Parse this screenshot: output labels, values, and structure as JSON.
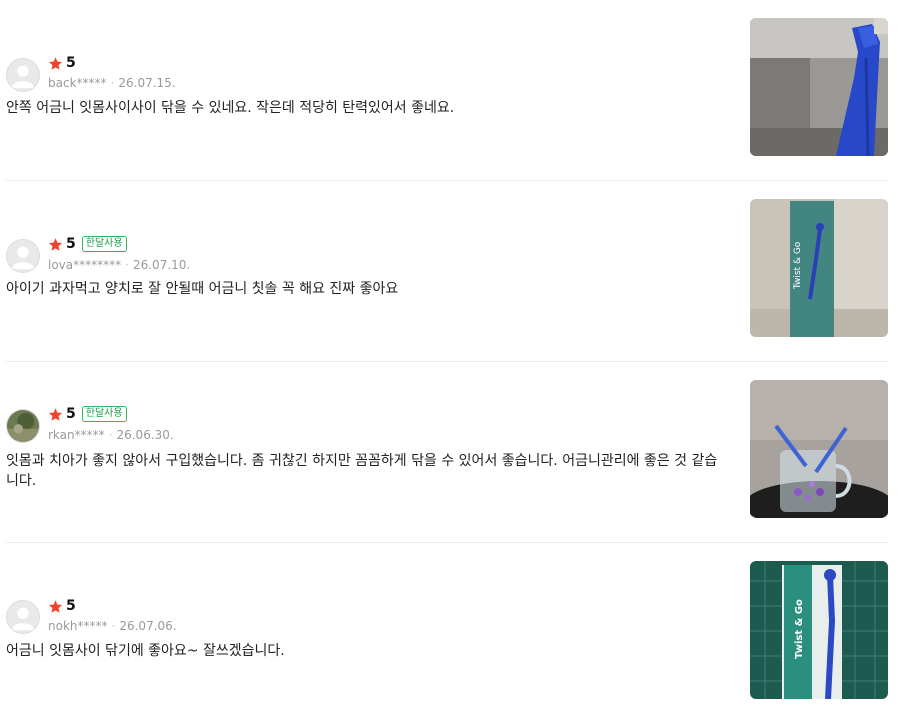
{
  "reviews": [
    {
      "score": "5",
      "badge": "",
      "user": "back*****",
      "date": "26.07.15.",
      "text": "안쪽 어금니 잇몸사이사이 닦을 수 있네요. 작은데 적당히 탄력있어서 좋네요.",
      "avatar": "default-avatar",
      "photo": "blue-toothbrush-photo"
    },
    {
      "score": "5",
      "badge": "한달사용",
      "user": "lova********",
      "date": "26.07.10.",
      "text": "아이기 과자먹고 양치로 잘 안될때 어금니 칫솔 꼭 해요 진짜 좋아요",
      "avatar": "default-avatar",
      "photo": "packaged-toothbrush-photo",
      "package_label": "Twist & Go"
    },
    {
      "score": "5",
      "badge": "한달사용",
      "user": "rkan*****",
      "date": "26.06.30.",
      "text": "잇몸과 치아가 좋지 않아서 구입했습니다. 좀 귀찮긴 하지만 꼼꼼하게 닦을 수 있어서 좋습니다. 어금니관리에 좋은 것 같습니다.",
      "avatar": "photo-avatar",
      "photo": "toothbrushes-in-glass-photo"
    },
    {
      "score": "5",
      "badge": "",
      "user": "nokh*****",
      "date": "26.07.06.",
      "text": "어금니 잇몸사이 닦기에 좋아요~ 잘쓰겠습니다.",
      "avatar": "default-avatar",
      "photo": "toothbrush-on-cutting-mat-photo",
      "package_label": "Twist & Go"
    }
  ],
  "colors": {
    "star": "#f0432c",
    "badge": "#1a9c4a",
    "meta": "#9a9a9a",
    "brush": "#2a4fcf"
  }
}
